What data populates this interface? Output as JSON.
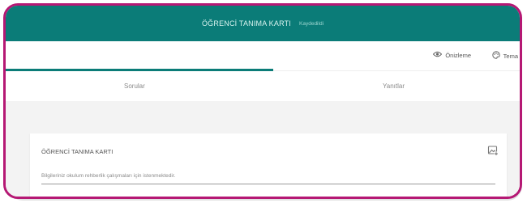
{
  "header": {
    "title": "ÖĞRENCİ TANIMA KARTI",
    "status": "Kaydedildi"
  },
  "toolbar": {
    "preview_label": "Önizleme",
    "theme_label": "Tema"
  },
  "tabs": [
    {
      "label": "Sorular"
    },
    {
      "label": "Yanıtlar"
    }
  ],
  "form": {
    "title": "ÖĞRENCİ TANIMA KARTI",
    "description": "Bilgileriniz okulum rehberlik çalışmaları için istenmektedir."
  },
  "colors": {
    "accent": "#0b7c78",
    "frame": "#b51874"
  },
  "icons": {
    "preview": "eye-icon",
    "theme": "palette-icon",
    "card": "image-icon"
  }
}
